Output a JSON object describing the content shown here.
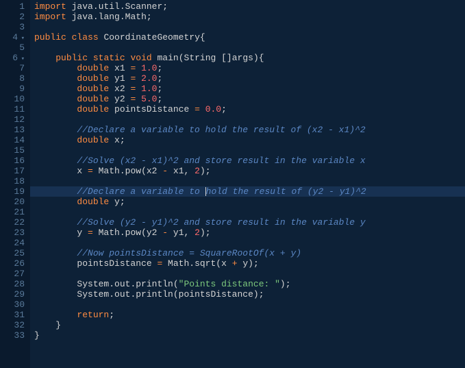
{
  "lines": [
    {
      "n": 1,
      "fold": "",
      "tokens": [
        [
          "kw",
          "import"
        ],
        [
          "ident",
          " java"
        ],
        [
          "punct",
          "."
        ],
        [
          "ident",
          "util"
        ],
        [
          "punct",
          "."
        ],
        [
          "ident",
          "Scanner"
        ],
        [
          "punct",
          ";"
        ]
      ]
    },
    {
      "n": 2,
      "fold": "",
      "tokens": [
        [
          "kw",
          "import"
        ],
        [
          "ident",
          " java"
        ],
        [
          "punct",
          "."
        ],
        [
          "ident",
          "lang"
        ],
        [
          "punct",
          "."
        ],
        [
          "ident",
          "Math"
        ],
        [
          "punct",
          ";"
        ]
      ]
    },
    {
      "n": 3,
      "fold": "",
      "tokens": []
    },
    {
      "n": 4,
      "fold": "▾",
      "tokens": [
        [
          "kw",
          "public"
        ],
        [
          "ident",
          " "
        ],
        [
          "kw",
          "class"
        ],
        [
          "ident",
          " CoordinateGeometry"
        ],
        [
          "punct",
          "{"
        ]
      ]
    },
    {
      "n": 5,
      "fold": "",
      "tokens": []
    },
    {
      "n": 6,
      "fold": "▾",
      "tokens": [
        [
          "ident",
          "    "
        ],
        [
          "kw",
          "public"
        ],
        [
          "ident",
          " "
        ],
        [
          "kw",
          "static"
        ],
        [
          "ident",
          " "
        ],
        [
          "kw",
          "void"
        ],
        [
          "ident",
          " main"
        ],
        [
          "punct",
          "("
        ],
        [
          "ident",
          "String "
        ],
        [
          "punct",
          "[]"
        ],
        [
          "ident",
          "args"
        ],
        [
          "punct",
          ")"
        ],
        [
          "punct",
          "{"
        ]
      ]
    },
    {
      "n": 7,
      "fold": "",
      "tokens": [
        [
          "ident",
          "        "
        ],
        [
          "type",
          "double"
        ],
        [
          "ident",
          " x1 "
        ],
        [
          "op",
          "="
        ],
        [
          "ident",
          " "
        ],
        [
          "num",
          "1.0"
        ],
        [
          "punct",
          ";"
        ]
      ]
    },
    {
      "n": 8,
      "fold": "",
      "tokens": [
        [
          "ident",
          "        "
        ],
        [
          "type",
          "double"
        ],
        [
          "ident",
          " y1 "
        ],
        [
          "op",
          "="
        ],
        [
          "ident",
          " "
        ],
        [
          "num",
          "2.0"
        ],
        [
          "punct",
          ";"
        ]
      ]
    },
    {
      "n": 9,
      "fold": "",
      "tokens": [
        [
          "ident",
          "        "
        ],
        [
          "type",
          "double"
        ],
        [
          "ident",
          " x2 "
        ],
        [
          "op",
          "="
        ],
        [
          "ident",
          " "
        ],
        [
          "num",
          "1.0"
        ],
        [
          "punct",
          ";"
        ]
      ]
    },
    {
      "n": 10,
      "fold": "",
      "tokens": [
        [
          "ident",
          "        "
        ],
        [
          "type",
          "double"
        ],
        [
          "ident",
          " y2 "
        ],
        [
          "op",
          "="
        ],
        [
          "ident",
          " "
        ],
        [
          "num",
          "5.0"
        ],
        [
          "punct",
          ";"
        ]
      ]
    },
    {
      "n": 11,
      "fold": "",
      "tokens": [
        [
          "ident",
          "        "
        ],
        [
          "type",
          "double"
        ],
        [
          "ident",
          " pointsDistance "
        ],
        [
          "op",
          "="
        ],
        [
          "ident",
          " "
        ],
        [
          "num",
          "0.0"
        ],
        [
          "punct",
          ";"
        ]
      ]
    },
    {
      "n": 12,
      "fold": "",
      "tokens": []
    },
    {
      "n": 13,
      "fold": "",
      "tokens": [
        [
          "ident",
          "        "
        ],
        [
          "cmt",
          "//Declare a variable to hold the result of (x2 - x1)^2"
        ]
      ]
    },
    {
      "n": 14,
      "fold": "",
      "tokens": [
        [
          "ident",
          "        "
        ],
        [
          "type",
          "double"
        ],
        [
          "ident",
          " x"
        ],
        [
          "punct",
          ";"
        ]
      ]
    },
    {
      "n": 15,
      "fold": "",
      "tokens": []
    },
    {
      "n": 16,
      "fold": "",
      "tokens": [
        [
          "ident",
          "        "
        ],
        [
          "cmt",
          "//Solve (x2 - x1)^2 and store result in the variable x"
        ]
      ]
    },
    {
      "n": 17,
      "fold": "",
      "tokens": [
        [
          "ident",
          "        x "
        ],
        [
          "op",
          "="
        ],
        [
          "ident",
          " Math"
        ],
        [
          "punct",
          "."
        ],
        [
          "ident",
          "pow"
        ],
        [
          "punct",
          "("
        ],
        [
          "ident",
          "x2 "
        ],
        [
          "op",
          "-"
        ],
        [
          "ident",
          " x1"
        ],
        [
          "punct",
          ","
        ],
        [
          "ident",
          " "
        ],
        [
          "num",
          "2"
        ],
        [
          "punct",
          ")"
        ],
        [
          "punct",
          ";"
        ]
      ]
    },
    {
      "n": 18,
      "fold": "",
      "tokens": []
    },
    {
      "n": 19,
      "fold": "",
      "hl": true,
      "tokens": [
        [
          "ident",
          "        "
        ],
        [
          "cmt",
          "//Declare a variable to "
        ],
        [
          "cursor",
          ""
        ],
        [
          "cmt",
          "hold the result of (y2 - y1)^2"
        ]
      ]
    },
    {
      "n": 20,
      "fold": "",
      "tokens": [
        [
          "ident",
          "        "
        ],
        [
          "type",
          "double"
        ],
        [
          "ident",
          " y"
        ],
        [
          "punct",
          ";"
        ]
      ]
    },
    {
      "n": 21,
      "fold": "",
      "tokens": []
    },
    {
      "n": 22,
      "fold": "",
      "tokens": [
        [
          "ident",
          "        "
        ],
        [
          "cmt",
          "//Solve (y2 - y1)^2 and store result in the variable y"
        ]
      ]
    },
    {
      "n": 23,
      "fold": "",
      "tokens": [
        [
          "ident",
          "        y "
        ],
        [
          "op",
          "="
        ],
        [
          "ident",
          " Math"
        ],
        [
          "punct",
          "."
        ],
        [
          "ident",
          "pow"
        ],
        [
          "punct",
          "("
        ],
        [
          "ident",
          "y2 "
        ],
        [
          "op",
          "-"
        ],
        [
          "ident",
          " y1"
        ],
        [
          "punct",
          ","
        ],
        [
          "ident",
          " "
        ],
        [
          "num",
          "2"
        ],
        [
          "punct",
          ")"
        ],
        [
          "punct",
          ";"
        ]
      ]
    },
    {
      "n": 24,
      "fold": "",
      "tokens": []
    },
    {
      "n": 25,
      "fold": "",
      "tokens": [
        [
          "ident",
          "        "
        ],
        [
          "cmt",
          "//Now pointsDistance = SquareRootOf(x + y)"
        ]
      ]
    },
    {
      "n": 26,
      "fold": "",
      "tokens": [
        [
          "ident",
          "        pointsDistance "
        ],
        [
          "op",
          "="
        ],
        [
          "ident",
          " Math"
        ],
        [
          "punct",
          "."
        ],
        [
          "ident",
          "sqrt"
        ],
        [
          "punct",
          "("
        ],
        [
          "ident",
          "x "
        ],
        [
          "op",
          "+"
        ],
        [
          "ident",
          " y"
        ],
        [
          "punct",
          ")"
        ],
        [
          "punct",
          ";"
        ]
      ]
    },
    {
      "n": 27,
      "fold": "",
      "tokens": []
    },
    {
      "n": 28,
      "fold": "",
      "tokens": [
        [
          "ident",
          "        System"
        ],
        [
          "punct",
          "."
        ],
        [
          "ident",
          "out"
        ],
        [
          "punct",
          "."
        ],
        [
          "ident",
          "println"
        ],
        [
          "punct",
          "("
        ],
        [
          "str",
          "\"Points distance: \""
        ],
        [
          "punct",
          ")"
        ],
        [
          "punct",
          ";"
        ]
      ]
    },
    {
      "n": 29,
      "fold": "",
      "tokens": [
        [
          "ident",
          "        System"
        ],
        [
          "punct",
          "."
        ],
        [
          "ident",
          "out"
        ],
        [
          "punct",
          "."
        ],
        [
          "ident",
          "println"
        ],
        [
          "punct",
          "("
        ],
        [
          "ident",
          "pointsDistance"
        ],
        [
          "punct",
          ")"
        ],
        [
          "punct",
          ";"
        ]
      ]
    },
    {
      "n": 30,
      "fold": "",
      "tokens": []
    },
    {
      "n": 31,
      "fold": "",
      "tokens": [
        [
          "ident",
          "        "
        ],
        [
          "kw",
          "return"
        ],
        [
          "punct",
          ";"
        ]
      ]
    },
    {
      "n": 32,
      "fold": "",
      "tokens": [
        [
          "ident",
          "    "
        ],
        [
          "punct",
          "}"
        ]
      ]
    },
    {
      "n": 33,
      "fold": "",
      "tokens": [
        [
          "punct",
          "}"
        ]
      ]
    }
  ]
}
